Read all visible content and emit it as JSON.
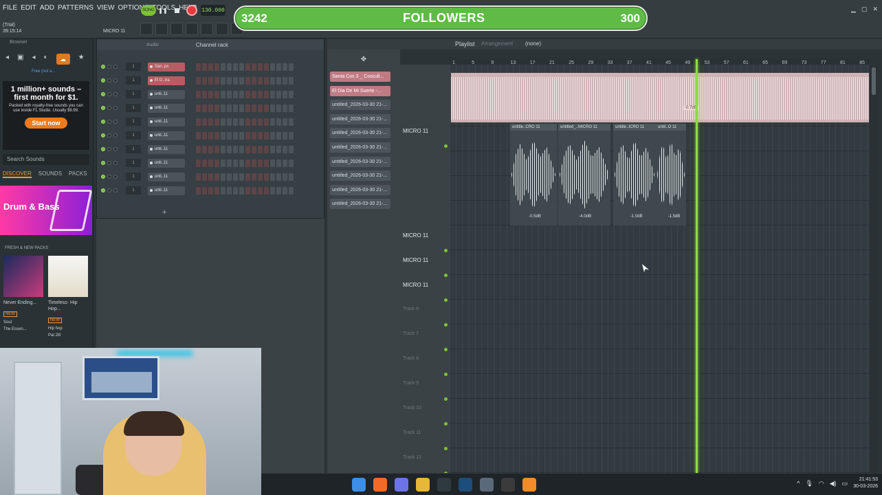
{
  "menu": [
    "FILE",
    "EDIT",
    "ADD",
    "PATTERNS",
    "VIEW",
    "OPTIONS",
    "TOOLS",
    "HELP"
  ],
  "trial": {
    "line1": "(Trial)",
    "line2": "39:15:14"
  },
  "hint": "MICRO 11",
  "transport": {
    "song_mode": "SONG",
    "tempo": "130.000"
  },
  "followers": {
    "count": "3242",
    "title": "FOLLOWERS",
    "goal": "300"
  },
  "browser": {
    "title": "Browser",
    "free_link": "Free (not a...",
    "ad": {
      "headline": "1 million+ sounds – first month for $1.",
      "body": "Packed with royalty-free sounds you can use inside FL Studio. Usually $9.99.",
      "cta": "Start now"
    },
    "search_placeholder": "Search Sounds",
    "tabs": [
      {
        "label": "DISCOVER",
        "active": true
      },
      {
        "label": "SOUNDS",
        "active": false
      },
      {
        "label": "PACKS",
        "active": false
      }
    ],
    "promo": "Drum & Bass",
    "packs_heading": "FRESH & NEW PACKS",
    "packs": [
      {
        "name": "Never Ending...",
        "tag": "NEW",
        "genre": "Soul",
        "author": "The Essen..."
      },
      {
        "name": "Timeless- Hip Hop...",
        "tag": "NEW",
        "genre": "Hip hop",
        "author": "Pat 2ill"
      }
    ]
  },
  "channel_rack": {
    "title": "Channel rack",
    "filter": "Audio",
    "channels": [
      {
        "num": "1",
        "name": "San..ps",
        "red": true
      },
      {
        "num": "1",
        "name": "El D..tra",
        "red": true
      },
      {
        "num": "1",
        "name": "unti..11",
        "red": false
      },
      {
        "num": "1",
        "name": "unti..11",
        "red": false
      },
      {
        "num": "1",
        "name": "unti..11",
        "red": false
      },
      {
        "num": "1",
        "name": "unti..11",
        "red": false
      },
      {
        "num": "1",
        "name": "unti..11",
        "red": false
      },
      {
        "num": "1",
        "name": "unti..11",
        "red": false
      },
      {
        "num": "1",
        "name": "unti..11",
        "red": false
      },
      {
        "num": "1",
        "name": "unti..11",
        "red": false
      }
    ],
    "add": "+"
  },
  "patterns": [
    {
      "label": "Santa Cos 3 _ Coscull...",
      "selected": true
    },
    {
      "label": "El Dia De Mi Suerte -...",
      "selected": true
    },
    {
      "label": "untitled_2026-03-30 21-...",
      "selected": false
    },
    {
      "label": "untitled_2026-03-30 21-...",
      "selected": false
    },
    {
      "label": "untitled_2026-03-30 21-...",
      "selected": false
    },
    {
      "label": "untitled_2026-03-30 21-...",
      "selected": false
    },
    {
      "label": "untitled_2026-03-30 21-...",
      "selected": false
    },
    {
      "label": "untitled_2026-03-30 21-...",
      "selected": false
    },
    {
      "label": "untitled_2026-03-30 21-...",
      "selected": false
    },
    {
      "label": "untitled_2026-03-30 21-...",
      "selected": false
    }
  ],
  "playlist": {
    "title": "Playlist",
    "subtitle": "Arrangement",
    "pattern": "(none)",
    "ruler": [
      "1",
      "5",
      "9",
      "13",
      "17",
      "21",
      "25",
      "29",
      "33",
      "37",
      "41",
      "45",
      "49",
      "53",
      "57",
      "61",
      "65",
      "69",
      "73",
      "77",
      "81",
      "85"
    ],
    "tracks": [
      {
        "name": "MICRO 11",
        "dim": false
      },
      {
        "name": "MICRO 11",
        "dim": false
      },
      {
        "name": "MICRO 11",
        "dim": false
      },
      {
        "name": "MICRO 11",
        "dim": false
      },
      {
        "name": "Track 6",
        "dim": true
      },
      {
        "name": "Track 7",
        "dim": true
      },
      {
        "name": "Track 8",
        "dim": true
      },
      {
        "name": "Track 9",
        "dim": true
      },
      {
        "name": "Track 10",
        "dim": true
      },
      {
        "name": "Track 11",
        "dim": true
      },
      {
        "name": "Track 12",
        "dim": true
      }
    ],
    "big_clip_db": "-0.7dB",
    "clips": [
      {
        "label": "untitle..CRO 11",
        "db": "-0.5dB"
      },
      {
        "label": "untitled_..MICRO 11",
        "db": "-4.0dB"
      },
      {
        "label": "untitle..ICRO 11",
        "db": "-1.0dB"
      },
      {
        "label": "untit..O 11",
        "db": "-1.5dB"
      }
    ]
  },
  "taskbar": {
    "time": "21:41:53",
    "date": "30-03-2026"
  }
}
